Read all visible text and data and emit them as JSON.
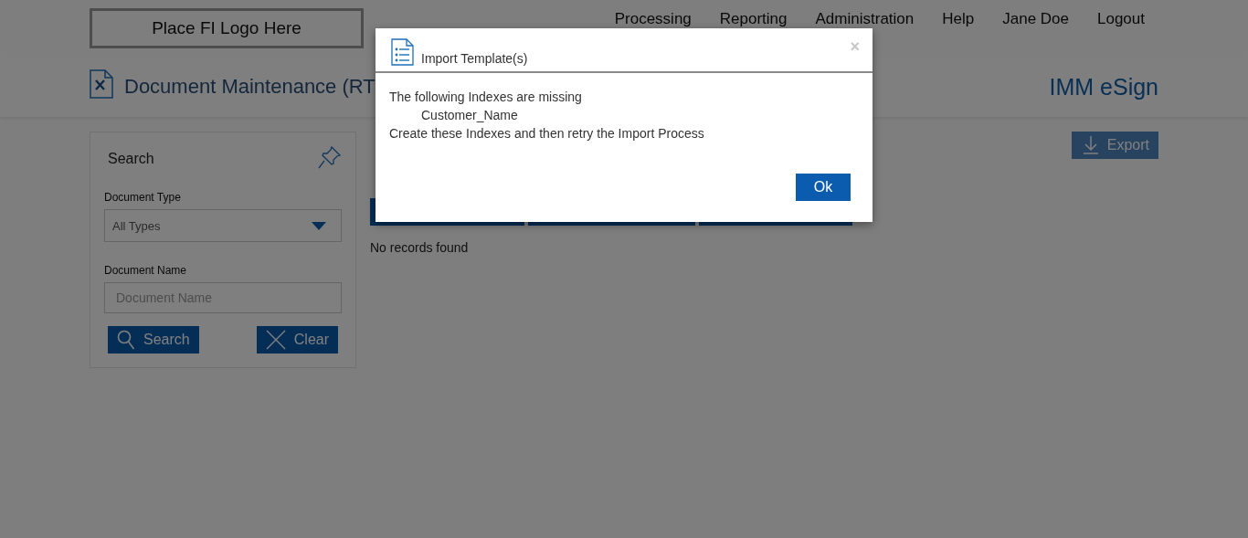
{
  "header": {
    "logo": "Place FI Logo Here",
    "nav": [
      "Processing",
      "Reporting",
      "Administration",
      "Help",
      "Jane Doe",
      "Logout"
    ]
  },
  "page_title": "Document Maintenance (RT",
  "app_name": "IMM eSign",
  "search_panel": {
    "title": "Search",
    "fields": [
      {
        "kind": "select",
        "label": "Document Type",
        "value": "All Types"
      },
      {
        "kind": "text",
        "label": "Document Name",
        "placeholder": "Document Name"
      }
    ],
    "buttons": [
      {
        "kind": "search",
        "label": "Search"
      },
      {
        "kind": "clear",
        "label": "Clear"
      }
    ]
  },
  "export": {
    "label": "Export",
    "disabled": true
  },
  "table": {
    "columns": [
      {
        "kind": "header"
      },
      {
        "kind": "header"
      },
      {
        "kind": "header"
      }
    ]
  },
  "empty_message": "No records found",
  "dialog": {
    "title": "Import Template(s)",
    "close": "×",
    "lines": [
      {
        "kind": "text",
        "text": "The following Indexes are missing"
      },
      {
        "kind": "item",
        "text": "Customer_Name"
      },
      {
        "kind": "text",
        "text": "Create these Indexes and then retry the Import Process"
      }
    ],
    "button": "Ok"
  }
}
